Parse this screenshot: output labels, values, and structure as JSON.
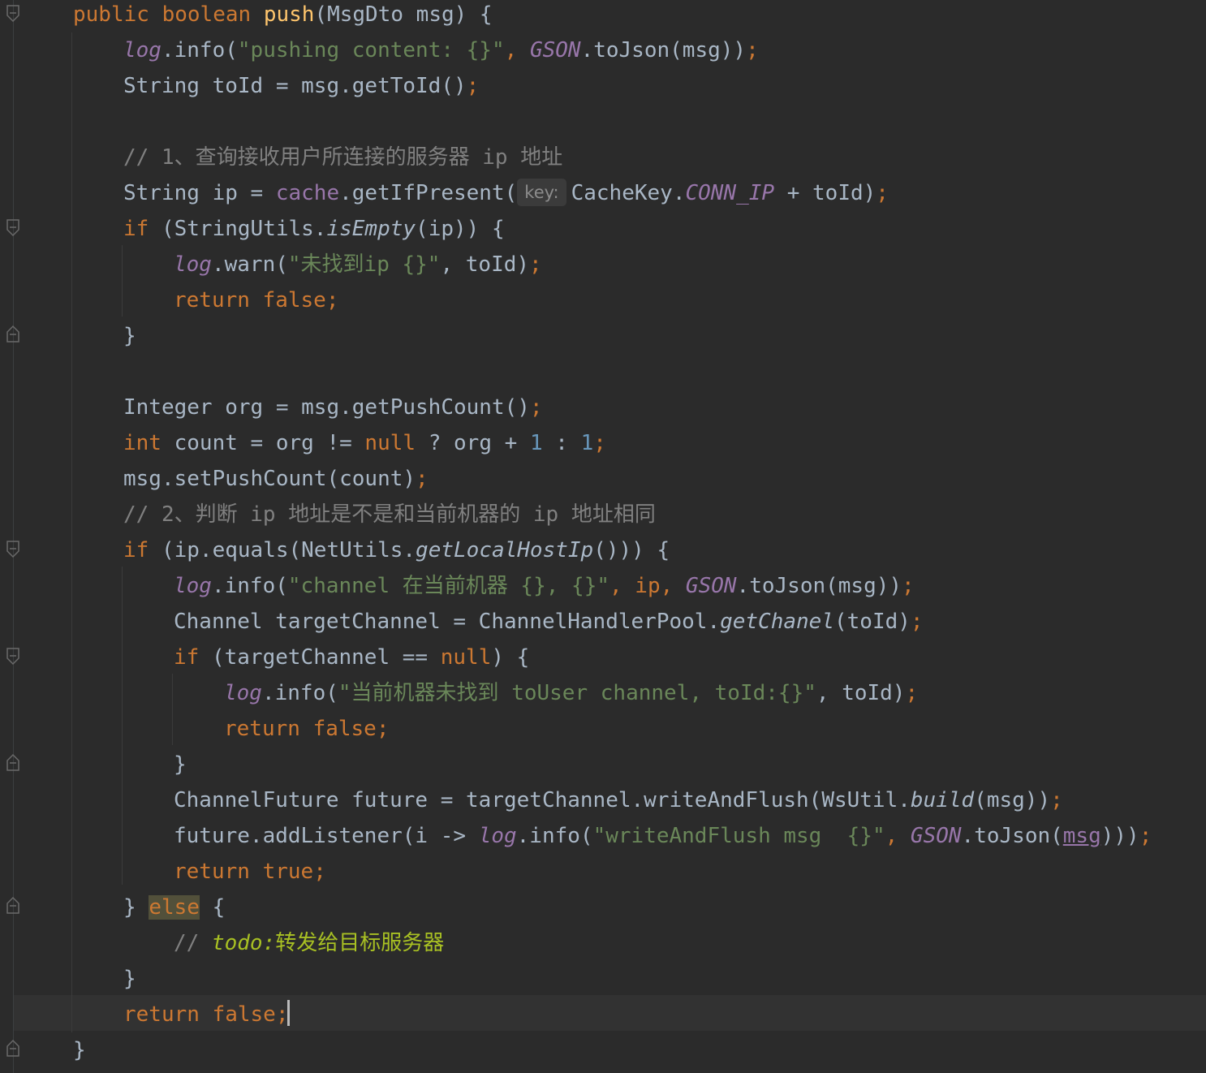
{
  "editor": {
    "theme_colors": {
      "background": "#2b2b2b",
      "keyword": "#cc7832",
      "method_decl": "#ffc66d",
      "string": "#6a8759",
      "number": "#6897bb",
      "field": "#9876aa",
      "comment": "#808080",
      "todo": "#a8c023",
      "default": "#a9b7c6"
    },
    "code": {
      "l1": {
        "kw1": "public",
        "kw2": "boolean",
        "fn": "push",
        "rest": "(MsgDto msg) {"
      },
      "l2": {
        "log": "log",
        "a": ".info(",
        "s": "\"pushing content: {}\"",
        "b": ", ",
        "gson": "GSON",
        "c": ".toJson(msg))",
        "semi": ";"
      },
      "l3": {
        "text": "String toId = msg.getToId()",
        "semi": ";"
      },
      "l4": {
        "comment": "// 1、查询接收用户所连接的服务器 ip 地址"
      },
      "l5": {
        "a": "String ip = ",
        "cache": "cache",
        "b": ".getIfPresent(",
        "hint": "key:",
        "c": "CacheKey.",
        "connip": "CONN_IP",
        "d": " + toId)",
        "semi": ";"
      },
      "l6": {
        "kw": "if",
        "a": " (StringUtils.",
        "m": "isEmpty",
        "b": "(ip)) {"
      },
      "l7": {
        "log": "log",
        "a": ".warn(",
        "s": "\"未找到ip {}\"",
        "b": ", toId)",
        "semi": ";"
      },
      "l8": {
        "kw": "return false",
        "semi": ";"
      },
      "l9": {
        "text": "}"
      },
      "l10": {
        "text": "Integer org = msg.getPushCount()",
        "semi": ";"
      },
      "l11": {
        "kw": "int",
        "a": " count = org != ",
        "nul": "null",
        "b": " ? org + ",
        "n1": "1",
        "c": " : ",
        "n2": "1",
        "semi": ";"
      },
      "l12": {
        "text": "msg.setPushCount(count)",
        "semi": ";"
      },
      "l13": {
        "comment": "// 2、判断 ip 地址是不是和当前机器的 ip 地址相同"
      },
      "l14": {
        "kw": "if",
        "a": " (ip.equals(NetUtils.",
        "m": "getLocalHostIp",
        "b": "())) {"
      },
      "l15": {
        "log": "log",
        "a": ".info(",
        "s": "\"channel 在当前机器 {}, {}\"",
        "b": ", ip, ",
        "gson": "GSON",
        "c": ".toJson(msg))",
        "semi": ";"
      },
      "l16": {
        "a": "Channel targetChannel = ChannelHandlerPool.",
        "m": "getChanel",
        "b": "(toId)",
        "semi": ";"
      },
      "l17": {
        "kw": "if",
        "a": " (targetChannel == ",
        "nul": "null",
        "b": ") {"
      },
      "l18": {
        "log": "log",
        "a": ".info(",
        "s": "\"当前机器未找到 toUser channel, toId:{}\"",
        "b": ", toId)",
        "semi": ";"
      },
      "l19": {
        "kw": "return false",
        "semi": ";"
      },
      "l20": {
        "text": "}"
      },
      "l21": {
        "a": "ChannelFuture future = targetChannel.writeAndFlush(WsUtil.",
        "m": "build",
        "b": "(msg))",
        "semi": ";"
      },
      "l22": {
        "a": "future.addListener(i -> ",
        "log": "log",
        "b": ".info(",
        "s": "\"writeAndFlush msg  {}\"",
        "c": ", ",
        "gson": "GSON",
        "d": ".toJson(",
        "msg": "msg",
        "e": ")))",
        "semi": ";"
      },
      "l23": {
        "kw": "return true",
        "semi": ";"
      },
      "l24": {
        "a": "} ",
        "kw": "else",
        "b": " {"
      },
      "l25": {
        "a": "// ",
        "todo": "todo:",
        "b": "转发给目标服务器"
      },
      "l26": {
        "text": "}"
      },
      "l27": {
        "kw": "return false",
        "semi": ";"
      },
      "l28": {
        "text": "}"
      }
    }
  }
}
